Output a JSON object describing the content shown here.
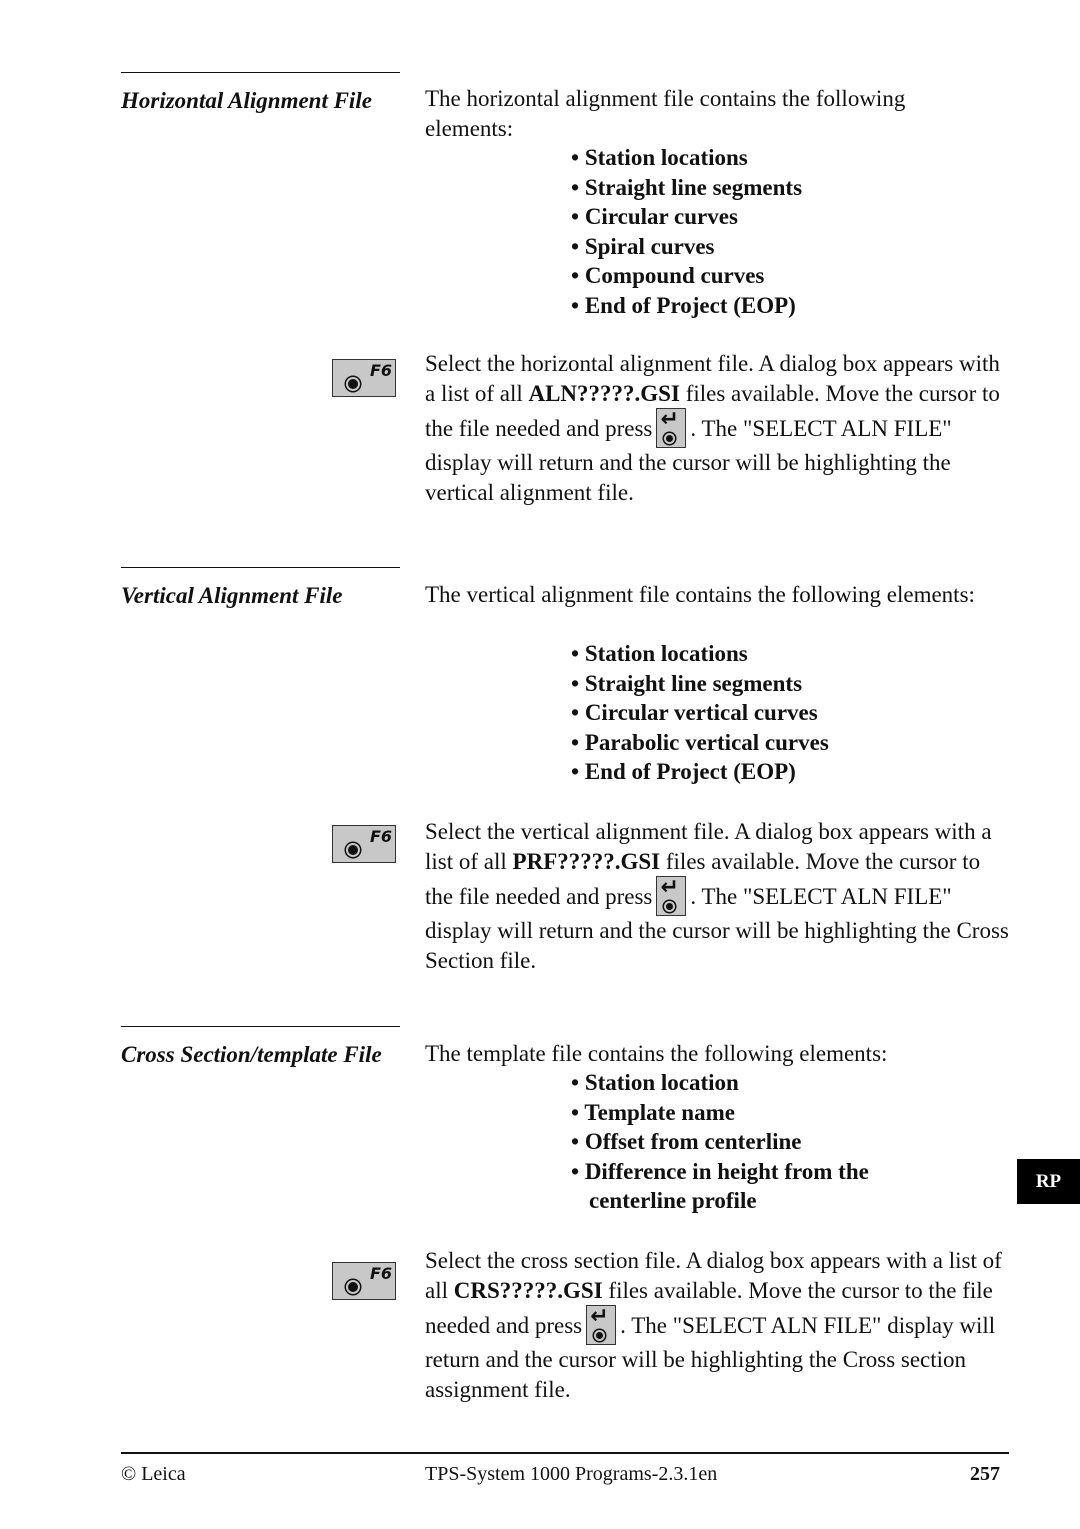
{
  "sections": [
    {
      "title": "Horizontal Alignment File",
      "intro": "The horizontal alignment file contains the following elements:",
      "bullets": [
        "Station locations",
        "Straight line segments",
        "Circular curves",
        "Spiral curves",
        "Compound curves",
        "End of Project (EOP)"
      ],
      "key_label": "F6",
      "instr_pre": "Select the horizontal alignment file. A dialog box appears with a list of all ",
      "instr_bold": "ALN?????.GSI",
      "instr_mid": " files available. Move the cursor to the file needed and press",
      "instr_post": ". The \"SELECT ALN FILE\" display will return and the cursor will be highlighting the vertical alignment file."
    },
    {
      "title": "Vertical Alignment File",
      "intro": "The vertical alignment file contains the following elements:",
      "bullets": [
        "Station locations",
        "Straight line segments",
        "Circular vertical curves",
        "Parabolic vertical curves",
        "End of Project (EOP)"
      ],
      "key_label": "F6",
      "instr_pre": "Select the vertical alignment file. A dialog box appears with a list of all ",
      "instr_bold": "PRF?????.GSI",
      "instr_mid": " files available. Move the cursor to the file needed and press",
      "instr_post": ". The \"SELECT ALN FILE\" display will return and the cursor will be highlighting the Cross Section file."
    },
    {
      "title": "Cross Section/template File",
      "intro": "The template file contains the following elements:",
      "bullets": [
        "Station location",
        "Template name",
        "Offset from centerline",
        "Difference in height from the"
      ],
      "bullet_cont": "centerline profile",
      "key_label": "F6",
      "instr_pre": "Select the cross section file. A dialog box appears with a list of all ",
      "instr_bold": "CRS?????.GSI",
      "instr_mid": " files available. Move the cursor to the file needed and press",
      "instr_post": ". The \"SELECT ALN FILE\" display will return and the cursor will be highlighting the Cross section assignment file."
    }
  ],
  "bullet_char": "•",
  "enter_icon": "↵",
  "side_tab": "RP",
  "footer": {
    "left": "© Leica",
    "center": "TPS-System 1000 Programs-2.3.1en",
    "page": "257"
  }
}
